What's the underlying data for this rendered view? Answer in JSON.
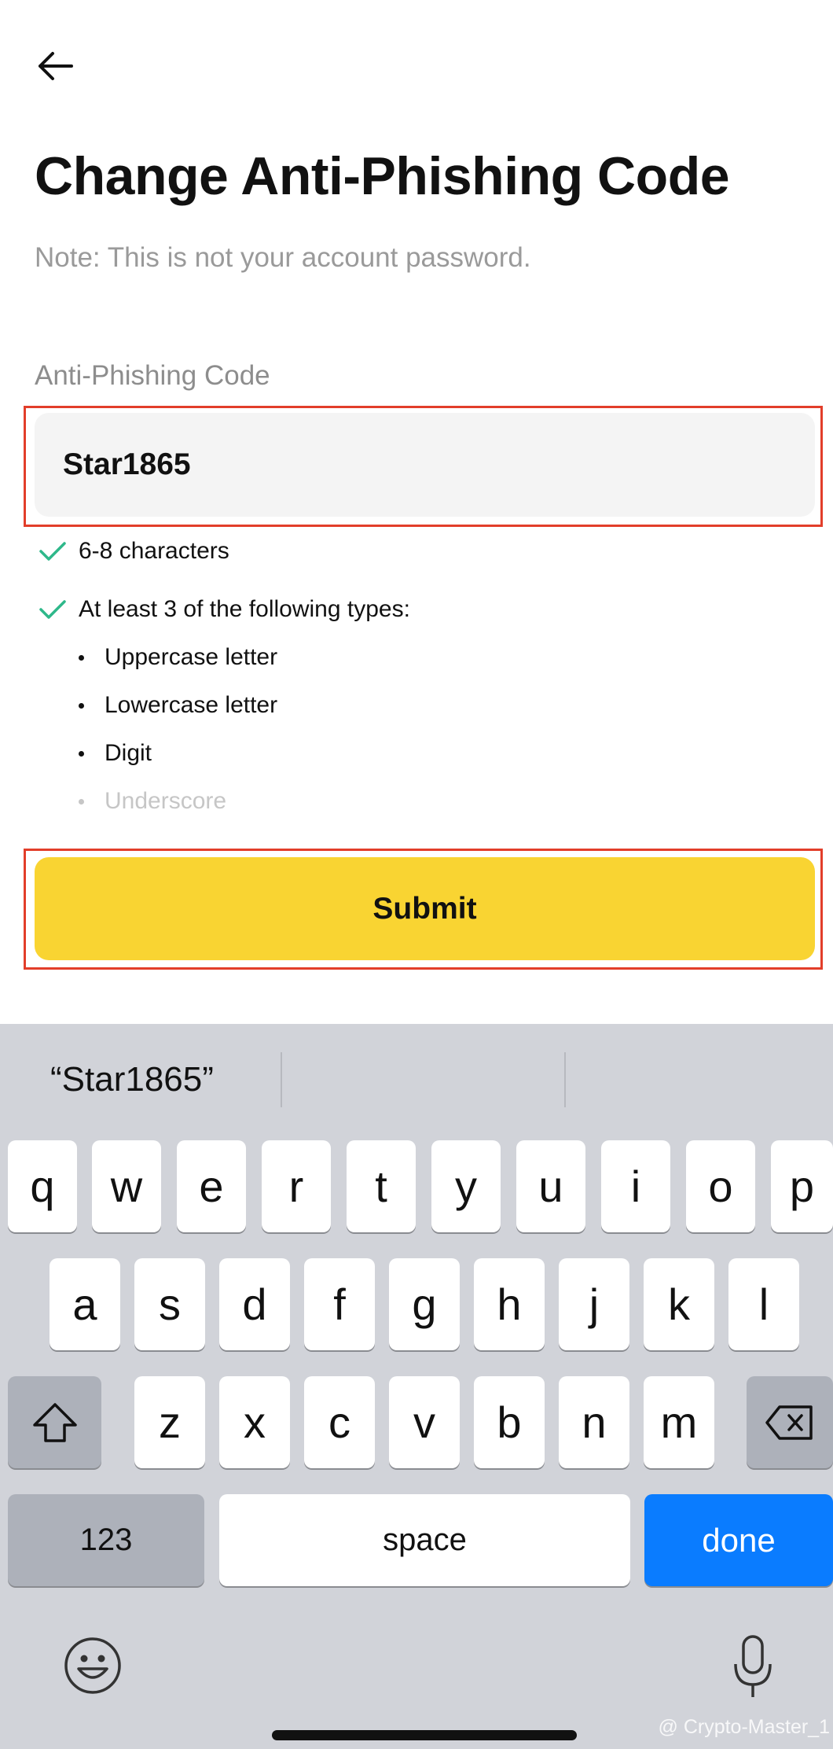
{
  "header": {
    "back_icon": "arrow-left-icon",
    "title": "Change Anti-Phishing Code",
    "note": "Note: This is not your account password."
  },
  "form": {
    "label": "Anti-Phishing Code",
    "value": "Star1865",
    "rules": [
      {
        "text": "6-8 characters",
        "met": true
      },
      {
        "text": "At least 3 of the following types:",
        "met": true
      }
    ],
    "types": [
      {
        "text": "Uppercase letter",
        "met": true
      },
      {
        "text": "Lowercase letter",
        "met": true
      },
      {
        "text": "Digit",
        "met": true
      },
      {
        "text": "Underscore",
        "met": false
      }
    ],
    "submit_label": "Submit"
  },
  "keyboard": {
    "suggestion": "“Star1865”",
    "row1": [
      "q",
      "w",
      "e",
      "r",
      "t",
      "y",
      "u",
      "i",
      "o",
      "p"
    ],
    "row2": [
      "a",
      "s",
      "d",
      "f",
      "g",
      "h",
      "j",
      "k",
      "l"
    ],
    "row3": [
      "z",
      "x",
      "c",
      "v",
      "b",
      "n",
      "m"
    ],
    "numbers_label": "123",
    "space_label": "space",
    "done_label": "done"
  },
  "watermark": "@ Crypto-Master_1",
  "colors": {
    "accent_yellow": "#f9d432",
    "check_green": "#2eb88a",
    "highlight_red": "#e23e2a",
    "done_blue": "#0a7cff"
  }
}
